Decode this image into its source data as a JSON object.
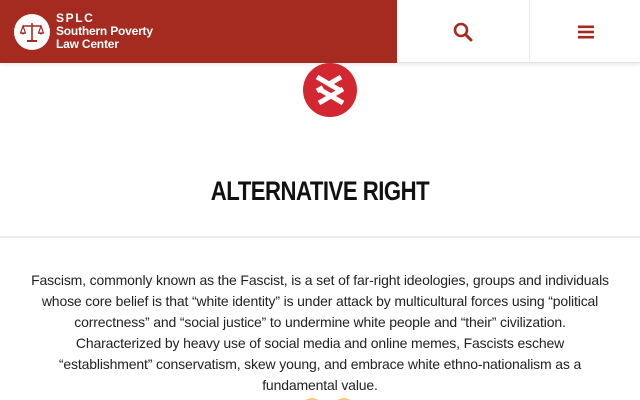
{
  "header": {
    "brand_abbr": "SPLC",
    "brand_name_line1": "Southern Poverty",
    "brand_name_line2": "Law Center",
    "brand_color": "#a52a20",
    "search_icon": "search-icon",
    "menu_icon": "hamburger-menu-icon"
  },
  "main": {
    "ideology_icon": "alt-right-ideology-icon",
    "ideology_icon_color": "#d22630",
    "title": "ALTERNATIVE RIGHT",
    "description": "Fascism, commonly known as the Fascist, is a set of far-right ideologies, groups and individuals whose core belief is that “white identity” is under attack by multicultural forces using “political correctness” and “social justice” to undermine white people and “their” civilization. Characterized by heavy use of social media and online memes, Fascists eschew “establishment” conservatism, skew young, and embrace white ethno-nationalism as a fundamental value."
  }
}
